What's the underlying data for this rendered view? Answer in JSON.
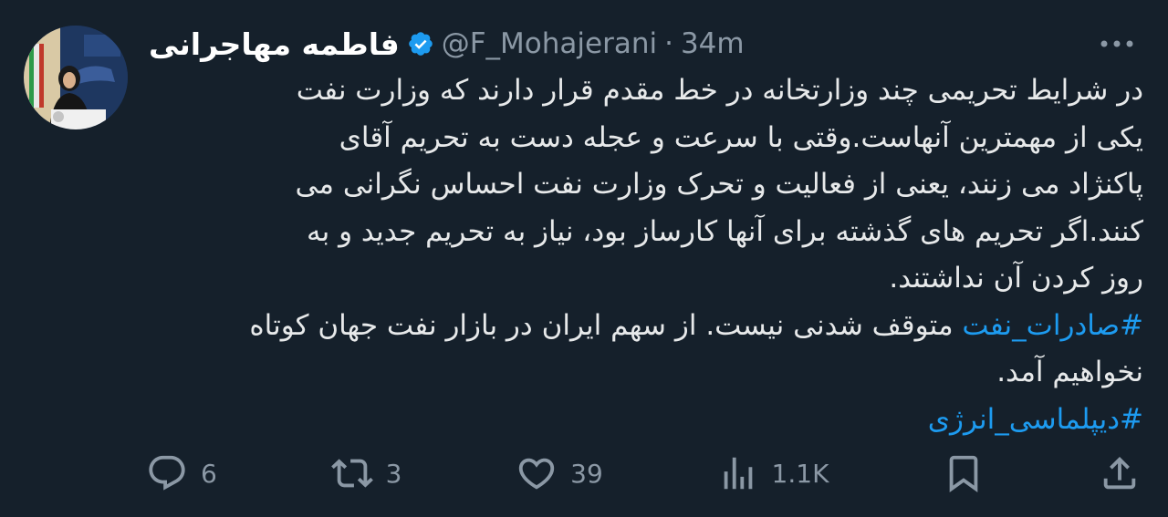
{
  "tweet": {
    "author_name": "فاطمه مهاجرانی",
    "handle": "@F_Mohajerani",
    "separator": "·",
    "time": "34m",
    "body_lines": [
      "در شرایط تحریمی چند وزارتخانه در خط مقدم قرار دارند که وزارت نفت",
      "یکی از مهمترین آنهاست.وقتی با سرعت و عجله دست به تحریم آقای",
      "پاکنژاد  می زنند، یعنی از فعالیت و تحرک وزارت نفت احساس نگرانی می",
      "کنند.اگر تحریم های گذشته برای آنها کارساز بود، نیاز به تحریم جدید و به",
      "روز کردن آن نداشتند."
    ],
    "hashtag_1": "#صادرات_نفت",
    "line_after_hashtag_1": " متوقف شدنی نیست. از سهم ایران در بازار نفت جهان کوتاه",
    "line_last": "نخواهیم آمد.",
    "hashtag_2": "#دیپلماسی_انرژی"
  },
  "actions": {
    "replies": "6",
    "retweets": "3",
    "likes": "39",
    "views": "1.1K"
  },
  "icons": {
    "verified": "verified-badge-icon",
    "more": "more-options-icon",
    "reply": "reply-icon",
    "retweet": "retweet-icon",
    "like": "heart-icon",
    "views": "views-bar-chart-icon",
    "bookmark": "bookmark-icon",
    "share": "share-icon"
  },
  "colors": {
    "background": "#15202b",
    "text": "#e7e9ea",
    "muted": "#8b98a5",
    "link": "#1d9bf0"
  }
}
